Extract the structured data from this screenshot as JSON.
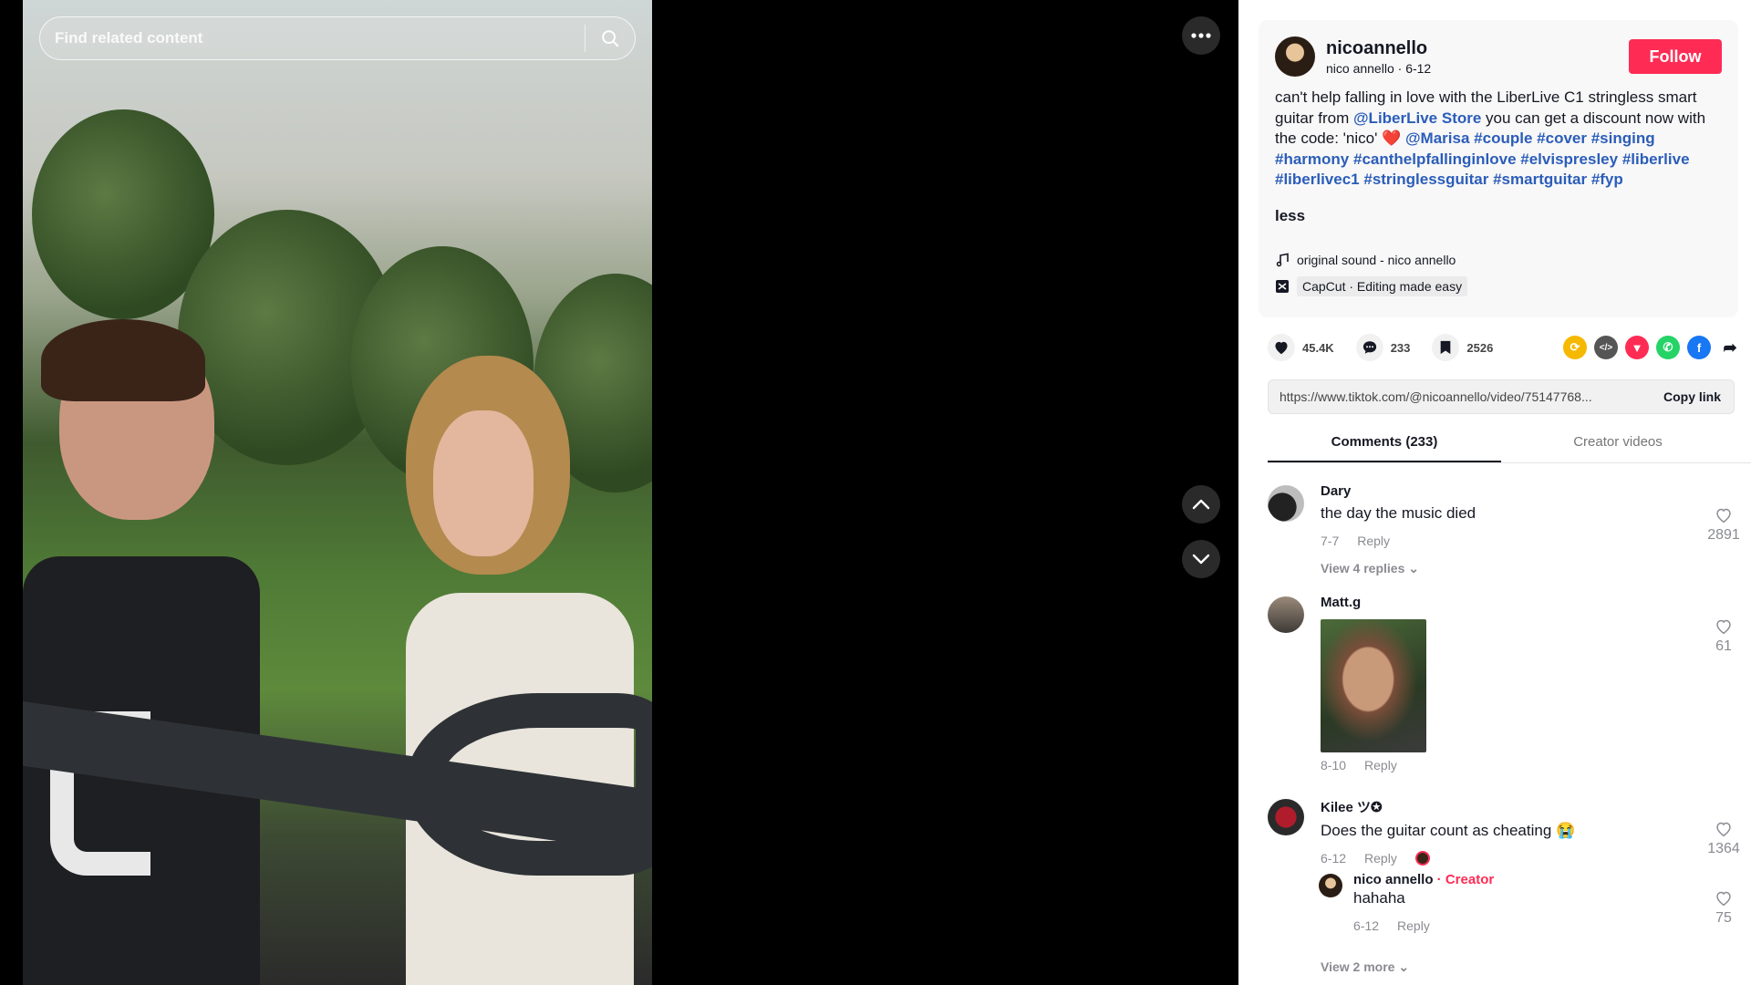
{
  "search": {
    "placeholder": "Find related content"
  },
  "author": {
    "username": "nicoannello",
    "display_name": "nico annello",
    "date": "6-12",
    "follow_label": "Follow"
  },
  "caption": {
    "part1": "can't help falling in love with the LiberLive C1 stringless smart guitar from ",
    "mention1": "@LiberLive Store",
    "part2": " you can get a discount now with the code: 'nico' ",
    "mention2": "@Marisa",
    "hashtags": [
      "#couple",
      "#cover",
      "#singing",
      "#harmony",
      "#canthelpfallinginlove",
      "#elvispresley",
      "#liberlive",
      "#liberlivec1",
      "#stringlessguitar",
      "#smartguitar",
      "#fyp"
    ],
    "less_label": "less"
  },
  "sound": "original sound - nico annello",
  "capcut": "CapCut · Editing made easy",
  "stats": {
    "likes": "45.4K",
    "comments": "233",
    "saves": "2526"
  },
  "link": {
    "url": "https://www.tiktok.com/@nicoannello/video/75147768...",
    "copy_label": "Copy link"
  },
  "tabs": [
    {
      "label": "Comments (233)"
    },
    {
      "label": "Creator videos"
    }
  ],
  "comments": [
    {
      "name": "Dary",
      "text": "the day the music died",
      "date": "7-7",
      "reply": "Reply",
      "likes": "2891",
      "view_more": "View 4 replies"
    },
    {
      "name": "Matt.g",
      "text": "",
      "date": "8-10",
      "reply": "Reply",
      "likes": "61"
    },
    {
      "name": "Kilee ツ✪",
      "text": "Does the guitar count as cheating 😭",
      "date": "6-12",
      "reply": "Reply",
      "likes": "1364",
      "view_more": "View 2 more"
    }
  ],
  "nested_reply": {
    "name": "nico annello",
    "badge": " · Creator",
    "text": "hahaha",
    "date": "6-12",
    "reply": "Reply",
    "likes": "75"
  },
  "colors": {
    "follow": "#fe2c55",
    "link": "#2b5db9",
    "creator": "#fe2c55"
  }
}
